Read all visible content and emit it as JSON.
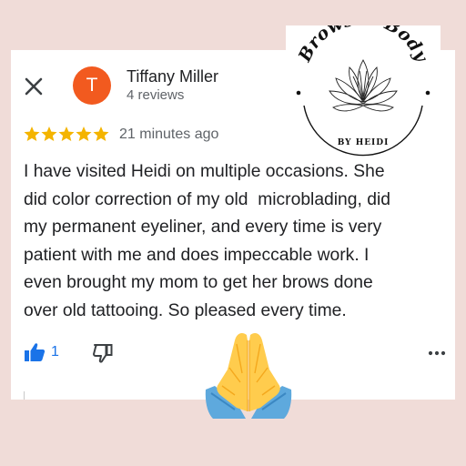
{
  "review": {
    "close_icon": "close-icon",
    "avatar_letter": "T",
    "avatar_color": "#f25a1f",
    "reviewer_name": "Tiffany Miller",
    "reviewer_sub": "4 reviews",
    "rating": 5,
    "rating_max": 5,
    "star_color": "#f4b400",
    "time_ago": "21 minutes ago",
    "text_lines": [
      "I have visited Heidi on multiple occasions. She",
      "did color correction of my old  microblading, did",
      "my permanent eyeliner, and every time is very",
      "patient with me and does impeccable work. I",
      "even brought my mom to get her brows done",
      "over old tattooing. So pleased every time."
    ],
    "like_icon": "thumbs-up-icon",
    "like_count": "1",
    "like_color": "#1a73e8",
    "dislike_icon": "thumbs-down-icon",
    "more_icon": "more-options-icon"
  },
  "logo": {
    "title": "Brows & Body",
    "subtitle": "BY HEIDI",
    "icon": "lotus-icon"
  },
  "overlay": {
    "icon": "praying-hands-icon"
  },
  "colors": {
    "background": "#f0dcd8",
    "card": "#ffffff",
    "text": "#202124",
    "secondary_text": "#5f6368"
  }
}
